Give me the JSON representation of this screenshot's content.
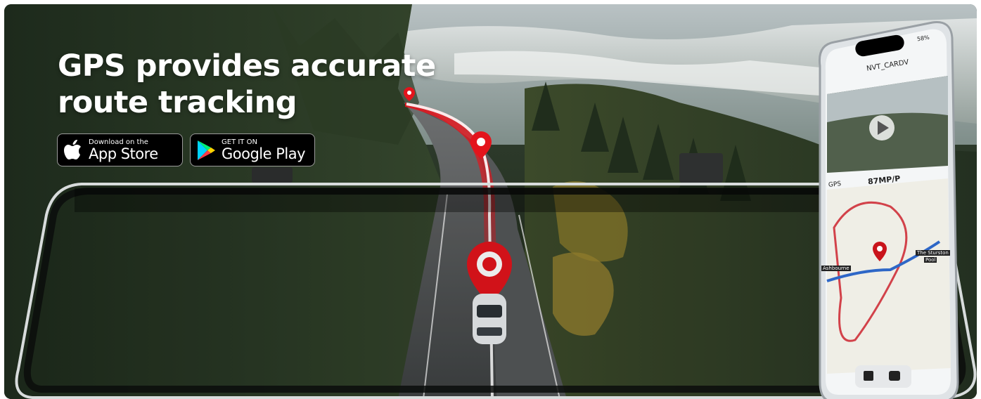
{
  "headline": {
    "line1": "GPS provides accurate",
    "line2": "route tracking"
  },
  "app_store": {
    "small": "Download on the",
    "big": "App Store",
    "icon": "apple-icon"
  },
  "google_play": {
    "small": "GET IT ON",
    "big": "Google Play",
    "icon": "google-play-icon"
  },
  "phone": {
    "device_name": "NVT_CARDV",
    "status_battery": "58%",
    "gps_label": "GPS",
    "speed": "87MP/P",
    "map_labels": [
      "Ashbourne",
      "The Sturston",
      "Pool"
    ]
  },
  "colors": {
    "route_red": "#e3141c",
    "headline": "#ffffff",
    "badge_bg": "#000000"
  }
}
